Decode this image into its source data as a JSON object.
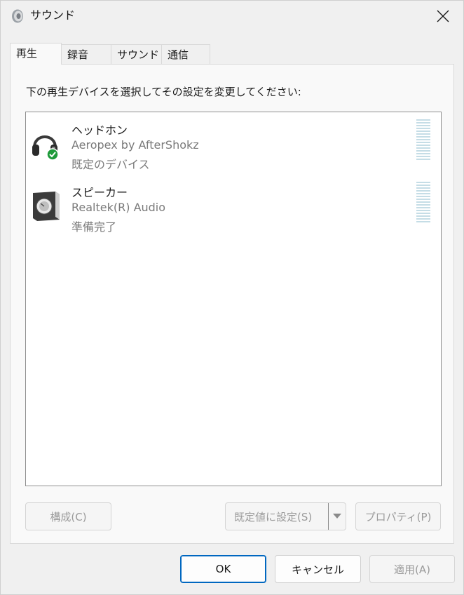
{
  "window": {
    "title": "サウンド"
  },
  "tabs": [
    {
      "label": "再生",
      "active": true
    },
    {
      "label": "録音",
      "active": false
    },
    {
      "label": "サウンド",
      "active": false
    },
    {
      "label": "通信",
      "active": false
    }
  ],
  "playback": {
    "instruction": "下の再生デバイスを選択してその設定を変更してください:",
    "devices": [
      {
        "name": "ヘッドホン",
        "description": "Aeropex by AfterShokz",
        "status": "既定のデバイス",
        "icon": "headphones-icon",
        "default": true
      },
      {
        "name": "スピーカー",
        "description": "Realtek(R) Audio",
        "status": "準備完了",
        "icon": "speaker-icon",
        "default": false
      }
    ],
    "buttons": {
      "configure": "構成(C)",
      "set_default": "既定値に設定(S)",
      "properties": "プロパティ(P)"
    }
  },
  "dialog_buttons": {
    "ok": "OK",
    "cancel": "キャンセル",
    "apply": "適用(A)"
  },
  "colors": {
    "accent": "#0067c0",
    "default_check": "#1e9a3a",
    "meter": "#c5dde6"
  }
}
